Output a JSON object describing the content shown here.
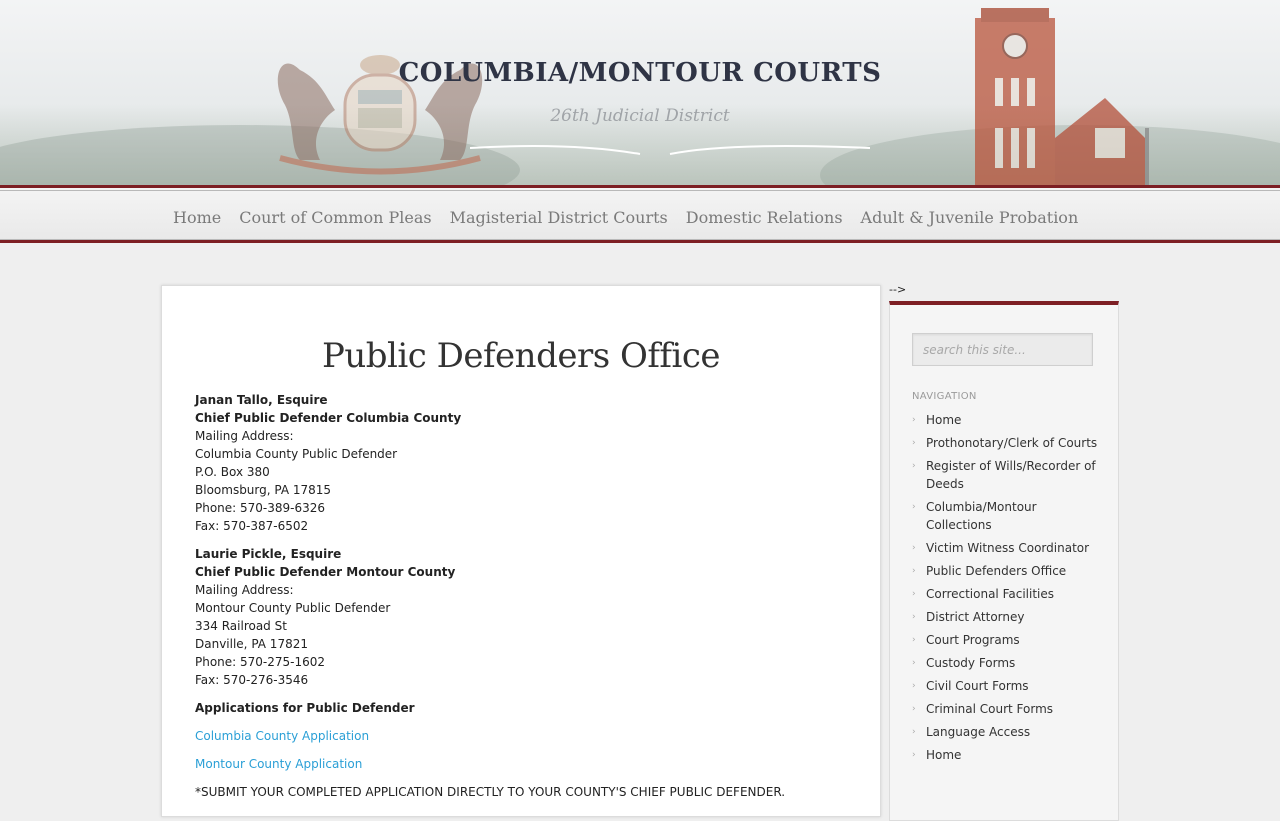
{
  "header": {
    "title": "COLUMBIA/MONTOUR COURTS",
    "subtitle": "26th Judicial District"
  },
  "nav": {
    "items": [
      {
        "label": "Home"
      },
      {
        "label": "Court of Common Pleas"
      },
      {
        "label": "Magisterial District Courts"
      },
      {
        "label": "Domestic Relations"
      },
      {
        "label": "Adult & Juvenile Probation"
      }
    ]
  },
  "content": {
    "title": "Public Defenders Office",
    "columbia": {
      "name": "Janan Tallo, Esquire",
      "role": "Chief Public Defender Columbia County",
      "mailing_label": "Mailing Address:",
      "org": "Columbia County Public Defender",
      "street": "P.O. Box 380",
      "city": "Bloomsburg, PA 17815",
      "phone": "Phone:  570-389-6326",
      "fax": "Fax: 570-387-6502"
    },
    "montour": {
      "name": "Laurie Pickle, Esquire",
      "role": "Chief Public Defender Montour County",
      "mailing_label": "Mailing Address:",
      "org": "Montour County Public Defender",
      "street": "334 Railroad St",
      "city": "Danville, PA 17821",
      "phone": "Phone:  570-275-1602",
      "fax": "Fax: 570-276-3546"
    },
    "applications_heading": "Applications for Public Defender",
    "columbia_app_link": "Columbia County Application",
    "montour_app_link": "Montour County Application",
    "note": "*SUBMIT YOUR COMPLETED APPLICATION DIRECTLY TO YOUR COUNTY'S CHIEF PUBLIC DEFENDER."
  },
  "sidebar": {
    "arrow_text": "-->",
    "search_placeholder": "search this site...",
    "nav_heading": "NAVIGATION",
    "bullet": "›",
    "items": [
      {
        "label": "Home"
      },
      {
        "label": "Prothonotary/Clerk of Courts"
      },
      {
        "label": "Register of Wills/Recorder of Deeds"
      },
      {
        "label": "Columbia/Montour Collections"
      },
      {
        "label": "Victim Witness Coordinator"
      },
      {
        "label": "Public Defenders Office"
      },
      {
        "label": "Correctional Facilities"
      },
      {
        "label": "District Attorney"
      },
      {
        "label": "Court Programs"
      },
      {
        "label": "Custody Forms"
      },
      {
        "label": "Civil Court Forms"
      },
      {
        "label": "Criminal Court Forms"
      },
      {
        "label": "Language Access"
      },
      {
        "label": "Home"
      }
    ]
  },
  "colors": {
    "accent": "#7d1f24",
    "link": "#2a9fd6"
  }
}
